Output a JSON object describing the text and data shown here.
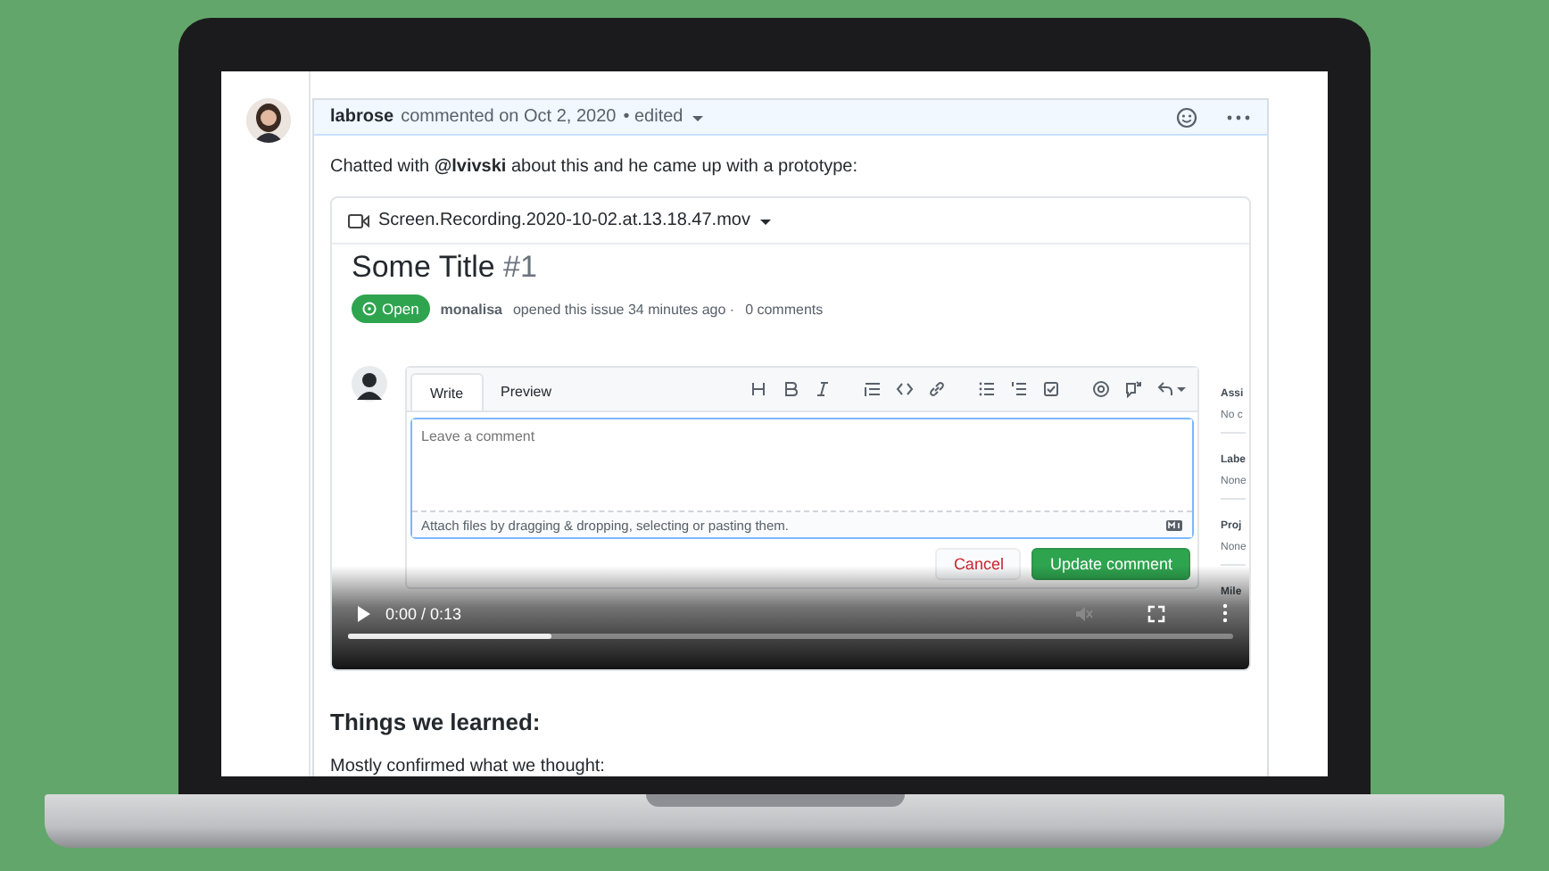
{
  "comment": {
    "author": "labrose",
    "meta": "commented on Oct 2, 2020",
    "edited": "• edited",
    "body": "Chatted with **@lvivski** about this and he came up with a prototype:"
  },
  "attachment": {
    "filename": "Screen.Recording.2020-10-02.at.13.18.47.mov",
    "recording": {
      "title": "Some Title",
      "number": "#1",
      "status": "Open",
      "author": "monalisa",
      "meta": "opened this issue 34 minutes ago ·",
      "comments": "0 comments",
      "tabs": [
        {
          "label": "Write",
          "selected": true
        },
        {
          "label": "Preview",
          "selected": false
        }
      ],
      "placeholder": "Leave a comment",
      "hint": "Attach files by dragging & dropping, selecting or pasting them.",
      "cancel": "Cancel",
      "submit": "Update comment",
      "sidebar": [
        {
          "heading": "Assi",
          "value": "No c"
        },
        {
          "heading": "Labe",
          "value": "None"
        },
        {
          "heading": "Proj",
          "value": "None"
        },
        {
          "heading": "Mile"
        }
      ]
    },
    "player": {
      "time": "0:00 / 0:13",
      "level": 0.23
    }
  },
  "sections": [
    {
      "kind": "heading",
      "text": "Things we learned:"
    },
    {
      "kind": "paragraph",
      "text": "Mostly confirmed what we thought:"
    }
  ]
}
